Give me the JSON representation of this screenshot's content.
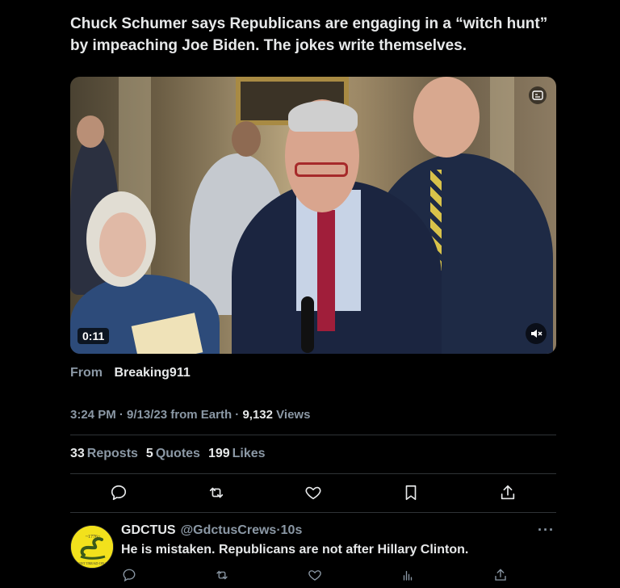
{
  "tweet": {
    "text": "Chuck Schumer says Republicans are engaging in a “witch hunt” by impeaching Joe Biden. The jokes write themselves.",
    "video": {
      "duration": "0:11"
    },
    "from_label": "From",
    "from_source": "Breaking911",
    "time": "3:24 PM",
    "date": "9/13/23",
    "location": "from Earth",
    "separator": "·",
    "views_count": "9,132",
    "views_label": "Views",
    "reposts_count": "33",
    "reposts_label": "Reposts",
    "quotes_count": "5",
    "quotes_label": "Quotes",
    "likes_count": "199",
    "likes_label": "Likes"
  },
  "actions": [
    "reply-icon",
    "repost-icon",
    "like-icon",
    "bookmark-icon",
    "share-icon"
  ],
  "reply": {
    "name": "GDCTUS",
    "handle": "@GdctusCrews",
    "age": "10s",
    "more": "···",
    "text": "He is mistaken. Republicans are not after Hillary Clinton.",
    "avatar_top_text": "~1776~",
    "avatar_bottom_text": "DONT TREAD ON ME"
  },
  "colors": {
    "background": "#000000",
    "text": "#e7e9ea",
    "muted": "#8b98a5",
    "divider": "#2f3336",
    "avatar": "#f2e11c"
  }
}
